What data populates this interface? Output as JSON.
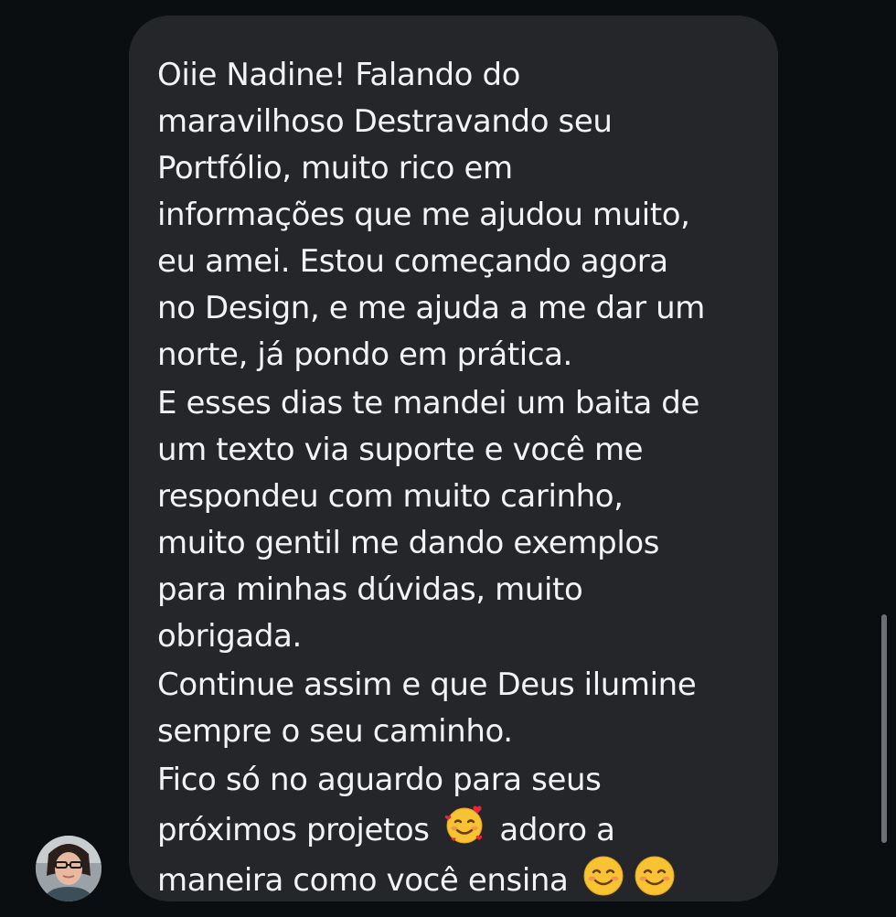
{
  "message": {
    "paragraphs": [
      "Oiie Nadine! Falando do\nmaravilhoso Destravando seu\nPortfólio, muito rico em\ninformações que me ajudou muito,\neu amei. Estou começando agora\nno Design, e me ajuda a me dar um\nnorte, já pondo em prática.",
      "E esses dias te mandei um baita de\num texto via suporte e você me\nrespondeu com muito carinho,\nmuito gentil me dando exemplos\npara minhas dúvidas, muito\nobrigada.",
      "Continue assim e que Deus ilumine\nsempre o seu caminho."
    ],
    "last_paragraph": {
      "line1": "Fico só no aguardo para seus",
      "line2_before": "próximos projetos",
      "line2_after": "adoro a",
      "line3": "maneira como você ensina"
    },
    "emojis": [
      "smiling-face-with-hearts-emoji",
      "smiling-face-emoji",
      "smiling-face-emoji"
    ]
  },
  "sender": {
    "avatar": "sender-avatar"
  },
  "colors": {
    "background": "#0b0e11",
    "bubble": "#242629",
    "text": "#f2f3f5"
  }
}
